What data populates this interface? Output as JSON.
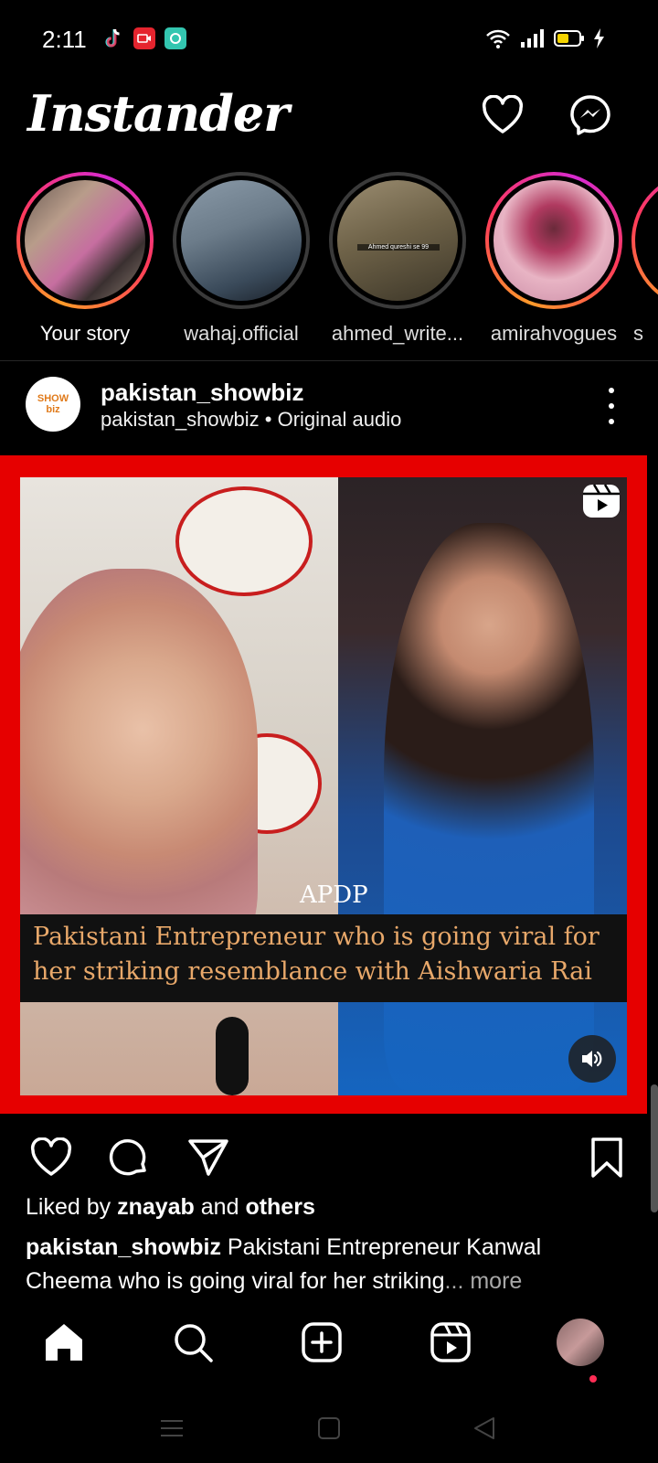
{
  "status_bar": {
    "time": "2:11",
    "left_icons": [
      "tiktok-icon",
      "video-record-icon",
      "chat-app-icon"
    ],
    "right_icons": [
      "wifi-icon",
      "signal-icon",
      "battery-icon",
      "charging-icon"
    ]
  },
  "header": {
    "brand": "Instander",
    "dropdown_icon": "chevron-down-icon",
    "actions": [
      "heart-icon",
      "messenger-icon"
    ]
  },
  "stories": [
    {
      "label": "Your story",
      "ring": "active"
    },
    {
      "label": "wahaj.official",
      "ring": "seen"
    },
    {
      "label": "ahmed_write...",
      "ring": "seen",
      "overlay": "Ahmed qureshi se 99"
    },
    {
      "label": "amirahvogues",
      "ring": "active"
    },
    {
      "label": "s",
      "ring": "active"
    }
  ],
  "post": {
    "username": "pakistan_showbiz",
    "subtitle": "pakistan_showbiz • Original audio",
    "avatar_text": "SHOW biz",
    "media": {
      "watermark": "APDP",
      "overlay_caption": "Pakistani Entrepreneur who is going viral for her striking resemblance with Aishwaria Rai",
      "reel_icon": "reels-icon",
      "sound_icon": "speaker-icon"
    },
    "liked_by_prefix": "Liked by ",
    "liked_by_user": "znayab",
    "liked_by_mid": " and ",
    "liked_by_others": "others",
    "caption_user": "pakistan_showbiz",
    "caption_text": " Pakistani Entrepreneur Kanwal Cheema who is going viral for her striking",
    "caption_ellipsis": "...",
    "caption_more": " more"
  },
  "bottom_nav": [
    "home-icon",
    "search-icon",
    "create-post-icon",
    "reels-icon",
    "profile-avatar"
  ],
  "system_nav": [
    "menu-icon",
    "home-square-icon",
    "back-icon"
  ]
}
